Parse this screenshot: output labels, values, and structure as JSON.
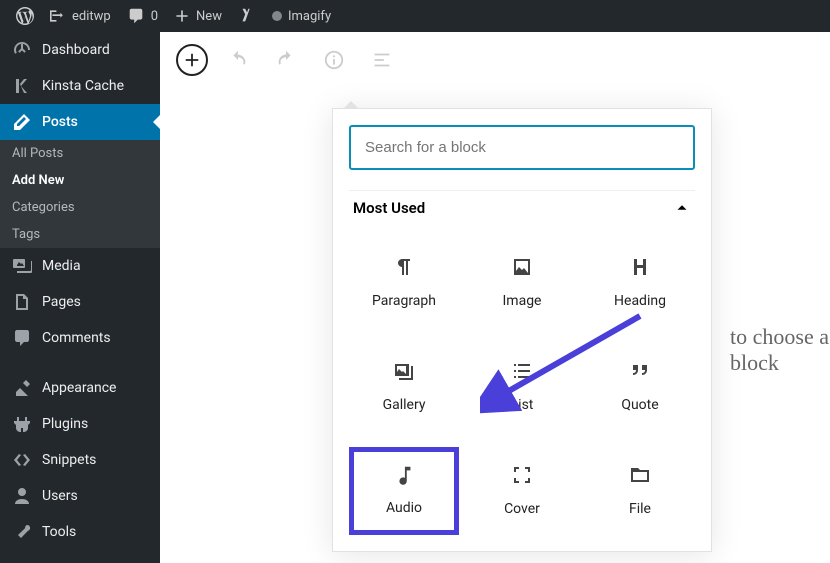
{
  "topbar": {
    "site": "editwp",
    "comments": "0",
    "new": "New",
    "imagify": "Imagify"
  },
  "sidebar": {
    "dashboard": "Dashboard",
    "kinsta": "Kinsta Cache",
    "posts": "Posts",
    "posts_sub": {
      "all": "All Posts",
      "add": "Add New",
      "cats": "Categories",
      "tags": "Tags"
    },
    "media": "Media",
    "pages": "Pages",
    "comments": "Comments",
    "appearance": "Appearance",
    "plugins": "Plugins",
    "snippets": "Snippets",
    "users": "Users",
    "tools": "Tools"
  },
  "editor": {
    "search_placeholder": "Search for a block",
    "section": "Most Used",
    "blocks": {
      "paragraph": "Paragraph",
      "image": "Image",
      "heading": "Heading",
      "gallery": "Gallery",
      "list": "List",
      "quote": "Quote",
      "audio": "Audio",
      "cover": "Cover",
      "file": "File"
    },
    "hint": "to choose a block"
  },
  "annotation": {
    "highlight_block": "audio",
    "arrow_color": "#4a3fd9"
  }
}
